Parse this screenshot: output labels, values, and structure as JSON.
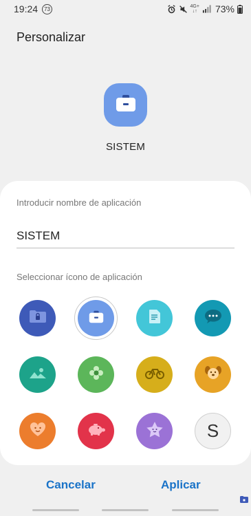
{
  "status_bar": {
    "time": "19:24",
    "notification_count": "73",
    "network": "4G+",
    "battery": "73%"
  },
  "header": {
    "title": "Personalizar"
  },
  "preview": {
    "app_name": "SISTEM",
    "icon": "briefcase-icon",
    "color": "#6f9be8"
  },
  "form": {
    "name_label": "Introducir nombre de aplicación",
    "name_value": "SISTEM",
    "icon_label": "Seleccionar ícono de aplicación"
  },
  "icons": [
    {
      "name": "folder-lock-icon",
      "color": "#3e5ab8",
      "selected": false
    },
    {
      "name": "briefcase-icon",
      "color": "#6f9be8",
      "selected": true
    },
    {
      "name": "document-icon",
      "color": "#43c6d8",
      "selected": false
    },
    {
      "name": "chat-bubble-icon",
      "color": "#1399b3",
      "selected": false
    },
    {
      "name": "landscape-icon",
      "color": "#1da38a",
      "selected": false
    },
    {
      "name": "flower-icon",
      "color": "#5cb65a",
      "selected": false
    },
    {
      "name": "bicycle-icon",
      "color": "#d6ae1b",
      "selected": false
    },
    {
      "name": "dog-icon",
      "color": "#e7a326",
      "selected": false
    },
    {
      "name": "heart-face-icon",
      "color": "#ec7d2d",
      "selected": false
    },
    {
      "name": "piggy-bank-icon",
      "color": "#e2334a",
      "selected": false
    },
    {
      "name": "star-face-icon",
      "color": "#9b72d6",
      "selected": false
    },
    {
      "name": "letter-icon",
      "letter": "S",
      "color": "#f1f1f1",
      "selected": false
    }
  ],
  "buttons": {
    "cancel": "Cancelar",
    "apply": "Aplicar"
  },
  "colors": {
    "accent": "#1a73c8",
    "background": "#f0f0f0"
  }
}
